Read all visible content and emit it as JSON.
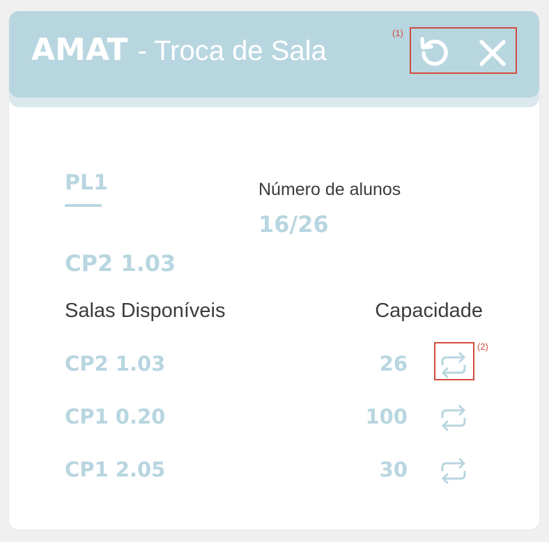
{
  "header": {
    "title_strong": "AMAT",
    "title_rest": "- Troca de Sala",
    "marker_1": "(1)",
    "reset_icon": "reset-rotate-icon",
    "close_icon": "close-x-icon",
    "bg_color": "#b8d6e0",
    "highlight_color": "#d24a3b"
  },
  "info": {
    "turma": "PL1",
    "students_label": "Número de alunos",
    "students_value": "16/26",
    "current_room": "CP2 1.03"
  },
  "table": {
    "col_rooms": "Salas Disponíveis",
    "col_capacity": "Capacidade",
    "marker_2": "(2)",
    "swap_icon": "swap-arrows-icon",
    "rows": [
      {
        "room": "CP2 1.03",
        "capacity": "26"
      },
      {
        "room": "CP1 0.20",
        "capacity": "100"
      },
      {
        "room": "CP1 2.05",
        "capacity": "30"
      }
    ]
  }
}
